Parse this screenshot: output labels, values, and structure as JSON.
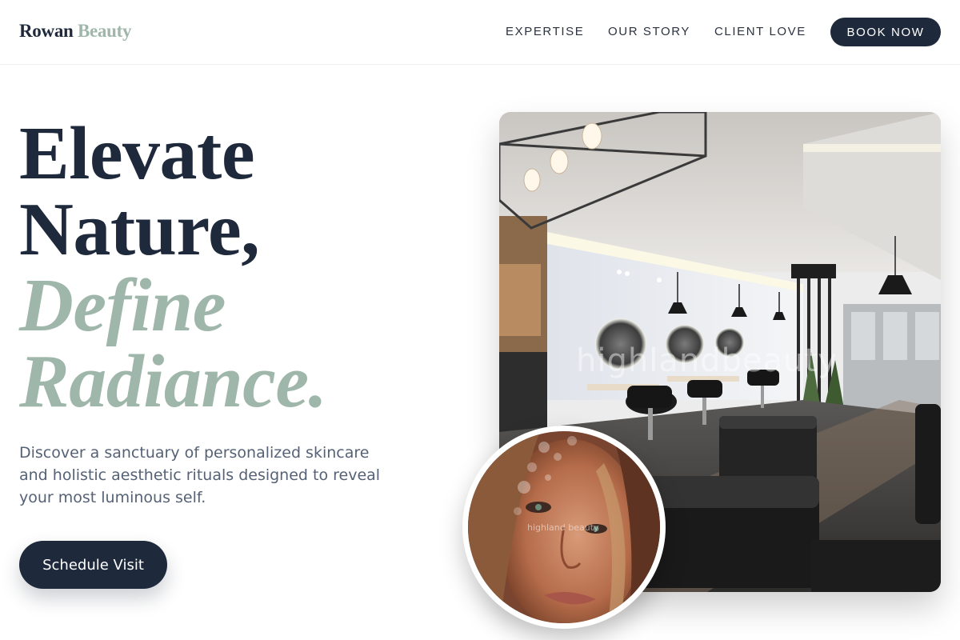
{
  "brand": {
    "name_primary": "Rowan",
    "name_accent": "Beauty"
  },
  "nav": {
    "items": [
      {
        "label": "EXPERTISE"
      },
      {
        "label": "OUR STORY"
      },
      {
        "label": "CLIENT LOVE"
      }
    ],
    "cta_label": "BOOK NOW"
  },
  "hero": {
    "headline_lines": [
      "Elevate",
      "Nature,"
    ],
    "headline_accent_lines": [
      "Define",
      "Radiance."
    ],
    "description": "Discover a sanctuary of personalized skincare and holistic aesthetic rituals designed to reveal your most luminous self.",
    "cta_label": "Schedule Visit"
  },
  "images": {
    "salon_watermark": "highlandbeauty",
    "portrait_watermark": "highland beauty",
    "salon_icon": "salon-interior-photo",
    "portrait_icon": "woman-portrait-photo"
  },
  "colors": {
    "navy": "#1e293b",
    "sage": "#9fb6aa",
    "body_text": "#556276",
    "background": "#ffffff"
  }
}
